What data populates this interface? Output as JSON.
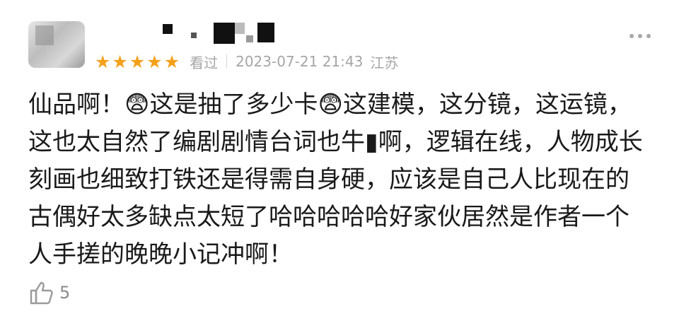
{
  "review": {
    "rating_stars": [
      "★",
      "★",
      "★",
      "★",
      "★"
    ],
    "rating": 5,
    "status": "看过",
    "datetime": "2023-07-21 21:43",
    "location": "江苏",
    "content": "仙品啊！😨这是抽了多少卡😨这建模，这分镜，这运镜，这也太自然了编剧剧情台词也牛▮啊，逻辑在线，人物成长刻画也细致打铁还是得需自身硬，应该是自己人比现在的古偶好太多缺点太短了哈哈哈哈哈好家伙居然是作者一个人手搓的晚晚小记冲啊！",
    "likes": "5"
  },
  "icons": {
    "star": "star-icon",
    "more": "more-dots-icon",
    "like": "thumbs-up-icon"
  },
  "colors": {
    "star": "#f5a01a",
    "meta_text": "#a6a6a6",
    "body_text": "#1a1a1a"
  }
}
